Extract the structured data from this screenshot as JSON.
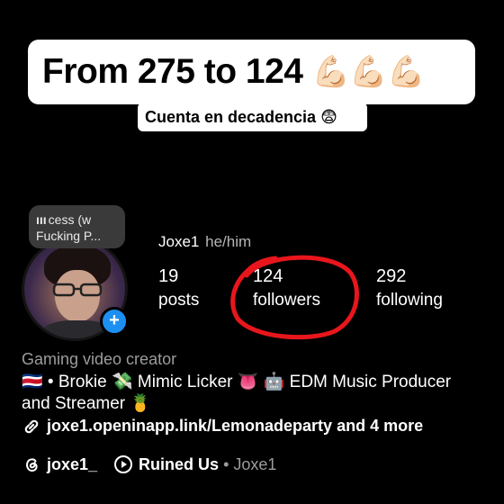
{
  "overlay": {
    "headline": "From 275 to 124",
    "headline_emoji": "💪🏻💪🏻💪🏻",
    "subheadline": "Cuenta en decadencia 😨"
  },
  "profile": {
    "note": {
      "line1": "cess (w",
      "line2": "Fucking P..."
    },
    "username": "Joxe1",
    "pronouns": "he/him",
    "stats": [
      {
        "value": "19",
        "label": "posts"
      },
      {
        "value": "124",
        "label": "followers"
      },
      {
        "value": "292",
        "label": "following"
      }
    ],
    "category": "Gaming video creator",
    "bio_line1": "🇨🇷 • Brokie 💸 Mimic Licker 👅 🤖 EDM Music Producer",
    "bio_line2": "and Streamer 🍍",
    "link": "joxe1.openinapp.link/Lemonadeparty and 4 more",
    "threads_handle": "joxe1_",
    "music_title": "Ruined Us",
    "music_separator": "•",
    "music_artist": "Joxe1"
  },
  "colors": {
    "background": "#000000",
    "annotation_circle": "#e8161c",
    "add_badge": "#1d8ff2",
    "muted_text": "#9c9c9c"
  },
  "icons": {
    "add": "plus-icon",
    "link": "link-icon",
    "threads": "threads-icon",
    "music": "play-circle-icon"
  }
}
